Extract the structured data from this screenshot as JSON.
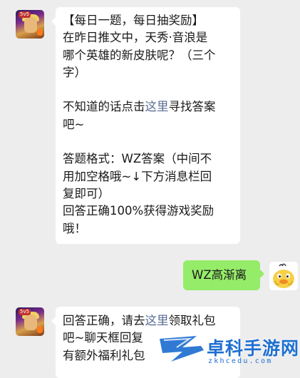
{
  "messages": [
    {
      "sender": "official-account",
      "avatar_badge": "5v5",
      "lines": [
        "【每日一题，每日抽奖励】",
        "在昨日推文中，天秀·音浪是",
        "哪个英雄的新皮肤呢？（三个",
        "字）",
        "",
        "不知道的话点击",
        "寻找答案",
        "吧~",
        "",
        "答题格式：WZ答案（中间不",
        "用加空格哦~↓下方消息栏回",
        "复即可）",
        "回答正确100%获得游戏奖励",
        "哦！"
      ],
      "link_text": "这里"
    },
    {
      "sender": "user",
      "text": "WZ高渐离"
    },
    {
      "sender": "official-account",
      "avatar_badge": "5v5",
      "line1_prefix": "回答正确，请去",
      "link_text": "这里",
      "line1_suffix": "领取礼包",
      "line2": "吧~聊天框回复",
      "line3": "有额外福利礼包"
    }
  ],
  "watermark": {
    "brand": "卓科手游网",
    "url": "zkhcedu.com"
  },
  "colors": {
    "background": "#ededed",
    "incoming_bubble": "#ffffff",
    "outgoing_bubble": "#95ec69",
    "link": "#576b95",
    "watermark_blue": "#1e6fd0"
  }
}
